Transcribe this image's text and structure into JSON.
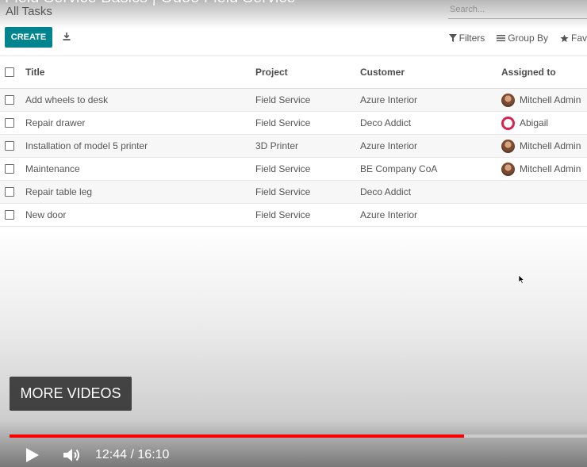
{
  "video": {
    "title": "Field Service Basics | Odoo Field Service",
    "more_videos_label": "MORE VIDEOS",
    "current_time": "12:44",
    "duration": "16:10",
    "time_separator": " / ",
    "progress_fraction": 0.787,
    "progress_color": "#ff0000"
  },
  "app": {
    "breadcrumb": "All Tasks",
    "search_placeholder": "Search...",
    "create_label": "CREATE",
    "filters_label": "Filters",
    "group_by_label": "Group By",
    "favorites_label": "Fav",
    "accent_color": "#00848d"
  },
  "table": {
    "columns": [
      "Title",
      "Project",
      "Customer",
      "Assigned to"
    ],
    "rows": [
      {
        "title": "Add wheels to desk",
        "project": "Field Service",
        "customer": "Azure Interior",
        "assigned": "Mitchell Admin",
        "avatar": "mitchell"
      },
      {
        "title": "Repair drawer",
        "project": "Field Service",
        "customer": "Deco Addict",
        "assigned": "Abigail",
        "avatar": "abigail"
      },
      {
        "title": "Installation of model 5 printer",
        "project": "3D Printer",
        "customer": "Azure Interior",
        "assigned": "Mitchell Admin",
        "avatar": "mitchell"
      },
      {
        "title": "Maintenance",
        "project": "Field Service",
        "customer": "BE Company CoA",
        "assigned": "Mitchell Admin",
        "avatar": "mitchell"
      },
      {
        "title": "Repair table leg",
        "project": "Field Service",
        "customer": "Deco Addict",
        "assigned": "",
        "avatar": ""
      },
      {
        "title": "New door",
        "project": "Field Service",
        "customer": "Azure Interior",
        "assigned": "",
        "avatar": ""
      }
    ]
  }
}
